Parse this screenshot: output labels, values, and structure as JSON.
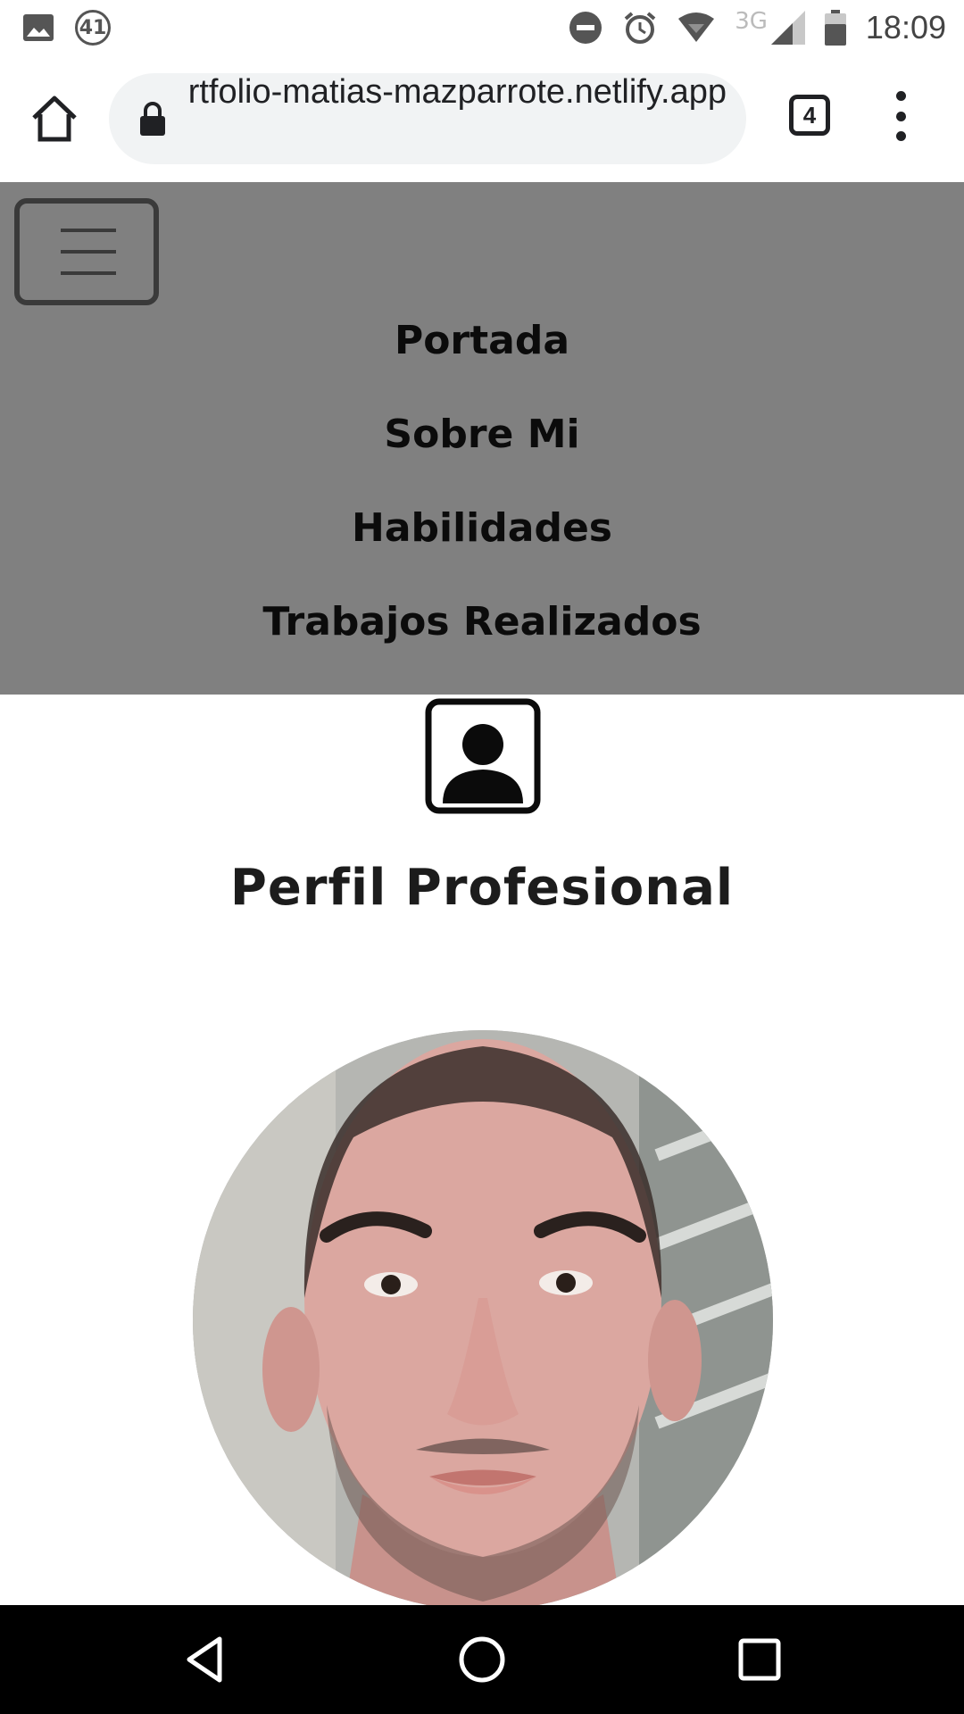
{
  "status_bar": {
    "notification_count": "41",
    "network_label": "3G",
    "time": "18:09"
  },
  "browser": {
    "url": "portfolio-matias-mazparrote.netlify.app",
    "tab_count": "4"
  },
  "nav": {
    "items": [
      {
        "label": "Portada"
      },
      {
        "label": "Sobre Mi"
      },
      {
        "label": "Habilidades"
      },
      {
        "label": "Trabajos Realizados"
      }
    ]
  },
  "main": {
    "section_title": "Perfil Profesional"
  },
  "icons": {
    "status_left": [
      "image-icon",
      "notification-count-icon"
    ],
    "status_right": [
      "do-not-disturb-icon",
      "alarm-icon",
      "wifi-icon",
      "cell-signal-icon",
      "battery-icon"
    ],
    "toolbar": [
      "home-icon",
      "lock-icon",
      "tab-switcher-icon",
      "overflow-menu-icon"
    ],
    "page": [
      "hamburger-icon",
      "profile-icon"
    ],
    "system_nav": [
      "back-icon",
      "home-circle-icon",
      "recents-icon"
    ]
  },
  "colors": {
    "nav_background": "#808080",
    "nav_text": "#0b0b0b",
    "page_background": "#ffffff",
    "omnibox_background": "#f1f3f4"
  }
}
